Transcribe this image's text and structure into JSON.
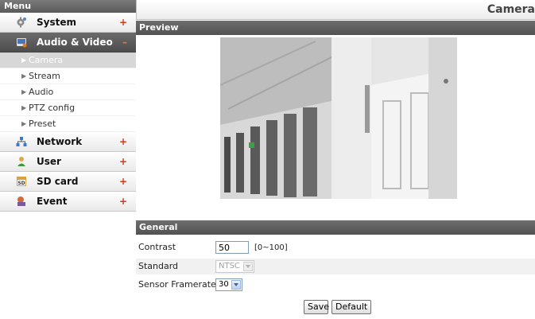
{
  "sidebar": {
    "header": "Menu",
    "items": [
      {
        "label": "System",
        "sign": "+",
        "icon": "gear-icon"
      },
      {
        "label": "Audio & Video",
        "sign": "–",
        "icon": "audio-video-icon"
      },
      {
        "label": "Network",
        "sign": "+",
        "icon": "network-icon"
      },
      {
        "label": "User",
        "sign": "+",
        "icon": "user-icon"
      },
      {
        "label": "SD card",
        "sign": "+",
        "icon": "sd-card-icon"
      },
      {
        "label": "Event",
        "sign": "+",
        "icon": "event-icon"
      }
    ],
    "sub_items": [
      {
        "label": "Camera"
      },
      {
        "label": "Stream"
      },
      {
        "label": "Audio"
      },
      {
        "label": "PTZ config"
      },
      {
        "label": "Preset"
      }
    ],
    "sd_icon_text": "SD"
  },
  "main": {
    "title": "Camera",
    "preview_section": "Preview",
    "general_section": "General",
    "contrast": {
      "label": "Contrast",
      "value": "50",
      "range": "[0~100]"
    },
    "standard": {
      "label": "Standard",
      "value": "NTSC"
    },
    "sensor_framerate": {
      "label": "Sensor Framerate",
      "value": "30"
    },
    "buttons": {
      "save": "Save",
      "default": "Default"
    }
  },
  "colors": {
    "header_bar": "#5a5a5a",
    "accent_sign": "#d03a1a",
    "input_border": "#7f9db9"
  }
}
